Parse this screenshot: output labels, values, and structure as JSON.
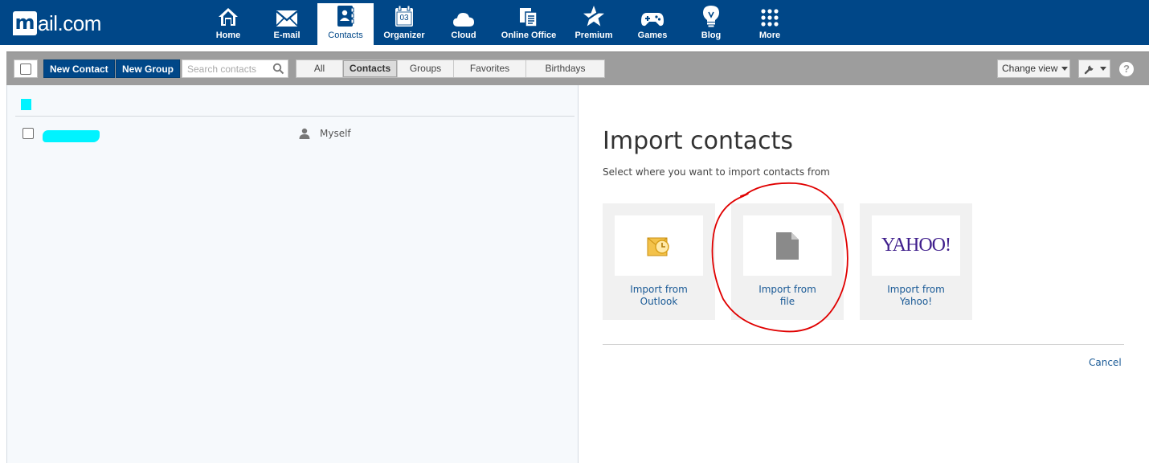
{
  "brand": {
    "logo_mark": "m",
    "logo_text": "ail.com"
  },
  "nav": {
    "items": [
      {
        "label": "Home",
        "icon": "home-icon"
      },
      {
        "label": "E-mail",
        "icon": "envelope-icon"
      },
      {
        "label": "Contacts",
        "icon": "address-book-icon",
        "active": true
      },
      {
        "label": "Organizer",
        "icon": "calendar-icon",
        "calendar_day": "03"
      },
      {
        "label": "Cloud",
        "icon": "cloud-icon"
      },
      {
        "label": "Online Office",
        "icon": "documents-icon"
      },
      {
        "label": "Premium",
        "icon": "star-icon"
      },
      {
        "label": "Games",
        "icon": "gamepad-icon"
      },
      {
        "label": "Blog",
        "icon": "lightbulb-icon"
      },
      {
        "label": "More",
        "icon": "grid-icon"
      }
    ]
  },
  "toolbar": {
    "new_contact": "New Contact",
    "new_group": "New Group",
    "search_placeholder": "Search contacts",
    "filters": [
      "All",
      "Contacts",
      "Groups",
      "Favorites",
      "Birthdays"
    ],
    "active_filter": "Contacts",
    "change_view": "Change view",
    "help": "?"
  },
  "contacts": {
    "rows": [
      {
        "name": "",
        "tag": "Myself"
      }
    ]
  },
  "import": {
    "title": "Import contacts",
    "subtitle": "Select where you want to import contacts from",
    "options": [
      {
        "label_line1": "Import from",
        "label_line2": "Outlook",
        "icon": "outlook-icon"
      },
      {
        "label_line1": "Import from",
        "label_line2": "file",
        "icon": "file-icon"
      },
      {
        "label_line1": "Import from",
        "label_line2": "Yahoo!",
        "icon": "yahoo-logo",
        "logo_text": "YAHOO!"
      }
    ],
    "cancel": "Cancel"
  },
  "colors": {
    "nav_bg": "#004788",
    "toolbar_bg": "#9d9d9d",
    "link": "#1a5a96",
    "redaction": "#00f3ff",
    "annotation": "#e00000"
  }
}
